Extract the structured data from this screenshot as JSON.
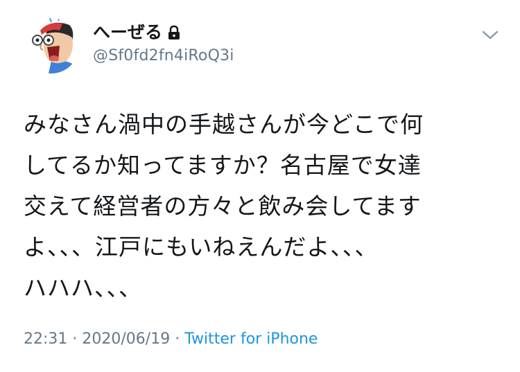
{
  "user": {
    "display_name": "へーぜる",
    "handle": "@Sf0fd2fn4iRoQ3i",
    "protected_icon": "lock-icon",
    "avatar_icon": "cartoon-face-avatar"
  },
  "tweet": {
    "text": "みなさん渦中の手越さんが今どこで何\nしてるか知ってますか？名古屋で女達\n交えて経営者の方々と飲み会してます\nよ、、、江戸にもいねえんだよ、、、\nハハハ、、、",
    "time": "22:31",
    "separator": "·",
    "date": "2020/06/19",
    "source": "Twitter for iPhone"
  },
  "menu": {
    "icon": "chevron-down-icon"
  },
  "colors": {
    "text": "#14171a",
    "secondary": "#657786",
    "link": "#1b95e0"
  }
}
